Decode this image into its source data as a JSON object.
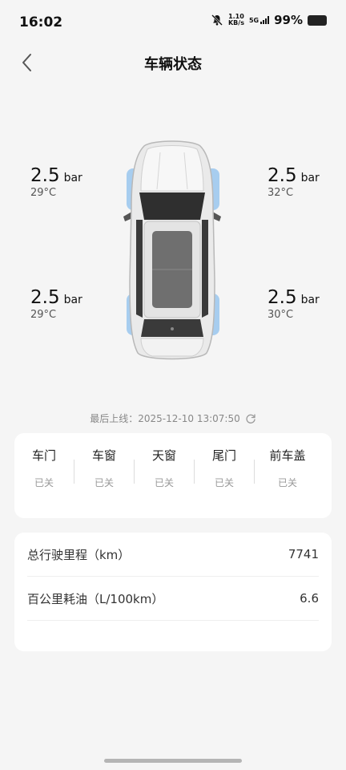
{
  "status_bar": {
    "time": "16:02",
    "speed_value": "1.10",
    "speed_unit": "KB/s",
    "network": "5G",
    "battery": "99%"
  },
  "header": {
    "title": "车辆状态",
    "back_icon": "chevron-left-icon"
  },
  "tires": {
    "front_left": {
      "pressure": "2.5",
      "unit": "bar",
      "temp": "29°C"
    },
    "front_right": {
      "pressure": "2.5",
      "unit": "bar",
      "temp": "32°C"
    },
    "rear_left": {
      "pressure": "2.5",
      "unit": "bar",
      "temp": "29°C"
    },
    "rear_right": {
      "pressure": "2.5",
      "unit": "bar",
      "temp": "30°C"
    }
  },
  "last_online": {
    "text": "最后上线：2025-12-10 13:07:50",
    "icon": "refresh-icon"
  },
  "status_items": [
    {
      "name": "车门",
      "value": "已关"
    },
    {
      "name": "车窗",
      "value": "已关"
    },
    {
      "name": "天窗",
      "value": "已关"
    },
    {
      "name": "尾门",
      "value": "已关"
    },
    {
      "name": "前车盖",
      "value": "已关"
    }
  ],
  "stats": [
    {
      "label": "总行驶里程（km）",
      "value": "7741"
    },
    {
      "label": "百公里耗油（L/100km）",
      "value": "6.6"
    }
  ],
  "colors": {
    "background": "#f5f5f5",
    "card": "#ffffff",
    "tire_highlight": "#9ec9ee",
    "text_primary": "#111111",
    "text_muted": "#999999"
  }
}
